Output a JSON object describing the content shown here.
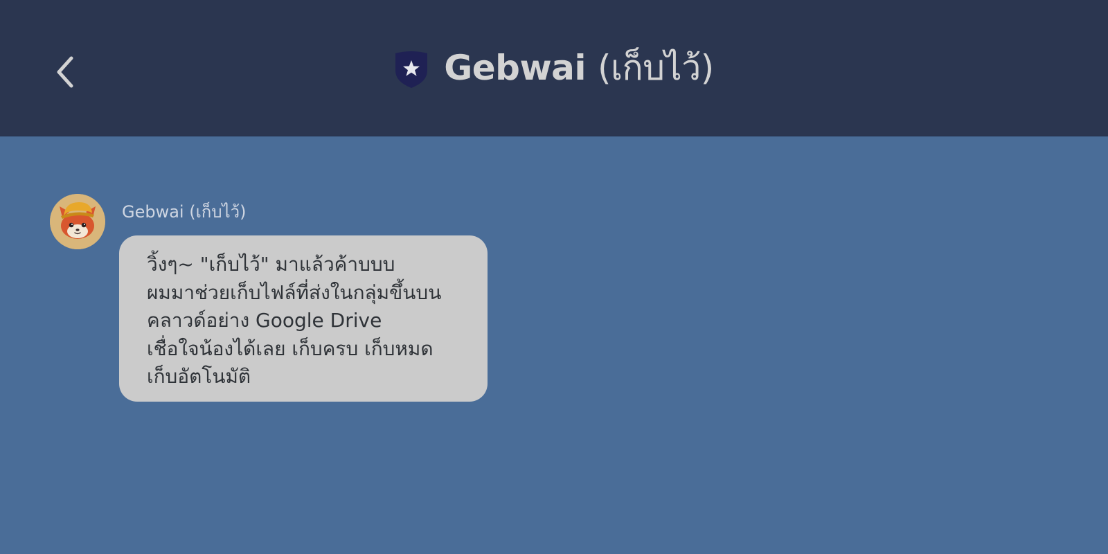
{
  "header": {
    "title_main": "Gebwai",
    "title_thai": "(เก็บไว้)",
    "back_icon": "chevron-left-icon",
    "badge_icon": "shield-star-icon"
  },
  "message": {
    "sender_name": "Gebwai (เก็บไว้)",
    "avatar_icon": "fox-mascot-avatar",
    "lines": [
      "วิ้งๆ~ \"เก็บไว้\" มาแล้วค้าบบบ",
      "ผมมาช่วยเก็บไฟล์ที่ส่งในกลุ่มขึ้นบน",
      "คลาวด์อย่าง Google Drive",
      "เชื่อใจน้องได้เลย เก็บครบ เก็บหมด",
      "เก็บอัตโนมัติ"
    ]
  },
  "colors": {
    "header_bg": "#2b3650",
    "chat_bg": "#4a6d98",
    "bubble_bg": "#cbcbcb",
    "shield": "#1f2154",
    "title_text": "#d3d3d3"
  }
}
